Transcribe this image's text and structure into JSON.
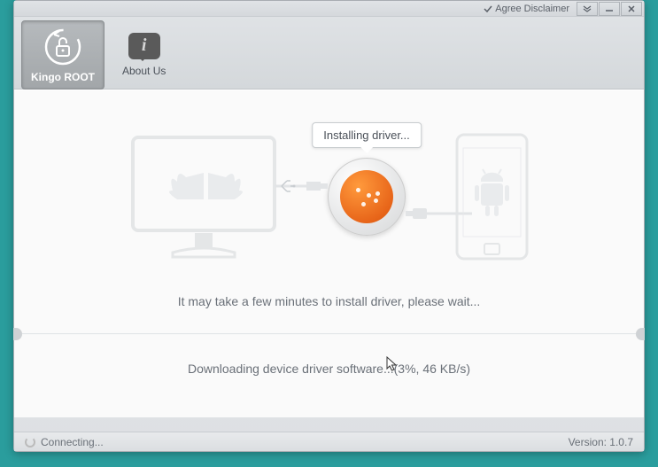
{
  "titlebar": {
    "agree_label": "Agree Disclaimer"
  },
  "toolbar": {
    "kingo_root_label": "Kingo ROOT",
    "about_us_label": "About Us"
  },
  "content": {
    "tooltip_text": "Installing driver...",
    "wait_text": "It may take a few minutes to install driver, please wait...",
    "download_text": "Downloading device driver software...(3%, 46 KB/s)",
    "progress_percent": 3,
    "speed_kbps": 46
  },
  "statusbar": {
    "status_text": "Connecting...",
    "version_label": "Version:",
    "version_value": "1.0.7"
  },
  "info_glyph": "i"
}
